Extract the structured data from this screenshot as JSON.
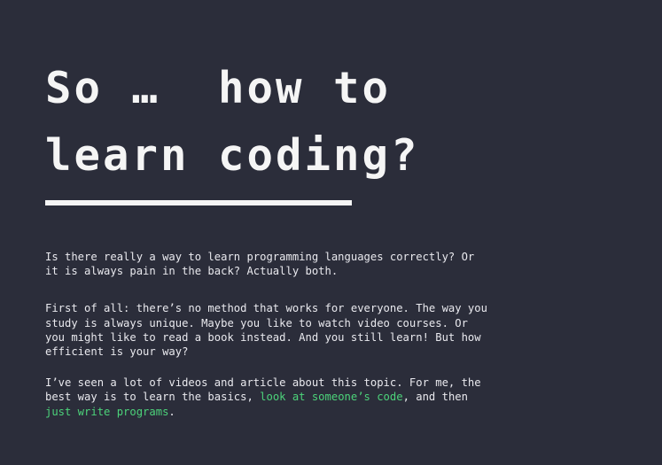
{
  "title": {
    "line1": "So …  how to",
    "line2": "learn coding?"
  },
  "paragraphs": {
    "p1": "Is there really a way to learn programming languages correctly? Or it is always pain in the back? Actually both.",
    "p2": "First of all: there’s no method that works for everyone. The way you study is always unique. Maybe you like to watch video courses. Or you might like to read a book instead. And you still learn! But how efficient is your way?",
    "p3": {
      "before": "I’ve seen a lot of videos and article about this topic. For me, the best way is to learn the basics, ",
      "link1": "look at someone’s code",
      "middle": ", and then ",
      "link2": "just write programs",
      "after": "."
    }
  },
  "colors": {
    "background": "#2b2d3a",
    "text": "#f2f2f2",
    "link": "#4cd37a"
  }
}
